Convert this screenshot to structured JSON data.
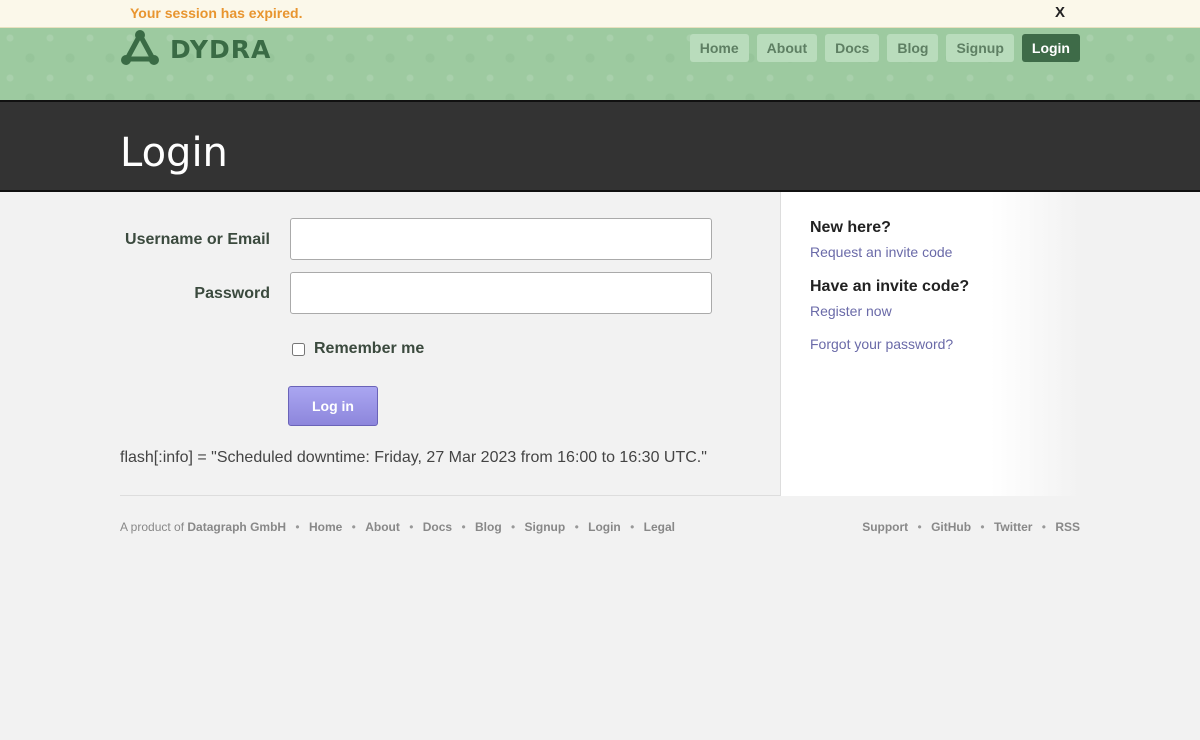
{
  "flash": {
    "message": "Your session has expired.",
    "close_label": "X"
  },
  "brand": {
    "name": "DYDRA"
  },
  "nav": {
    "items": [
      {
        "label": "Home"
      },
      {
        "label": "About"
      },
      {
        "label": "Docs"
      },
      {
        "label": "Blog"
      },
      {
        "label": "Signup"
      },
      {
        "label": "Login",
        "active": true
      }
    ]
  },
  "page": {
    "title": "Login"
  },
  "form": {
    "username_label": "Username or Email",
    "username_value": "",
    "password_label": "Password",
    "password_value": "",
    "remember_label": "Remember me",
    "remember_checked": false,
    "submit_label": "Log in"
  },
  "info_text": "flash[:info] = \"Scheduled downtime: Friday, 27 Mar 2023 from 16:00 to 16:30 UTC.\"",
  "sidebar": {
    "new_heading": "New here?",
    "request_link": "Request an invite code",
    "invite_heading": "Have an invite code?",
    "register_link": "Register now",
    "forgot_link": "Forgot your password?"
  },
  "footer": {
    "product_prefix": "A product of",
    "company": "Datagraph GmbH",
    "left_links": [
      "Home",
      "About",
      "Docs",
      "Blog",
      "Signup",
      "Login",
      "Legal"
    ],
    "right_links": [
      "Support",
      "GitHub",
      "Twitter",
      "RSS"
    ]
  },
  "colors": {
    "header_green": "#9dcaa0",
    "nav_active": "#3e6b48",
    "title_band": "#333333",
    "flash_text": "#e8952f",
    "button": "#8d86dc",
    "link": "#6a6aa8"
  }
}
